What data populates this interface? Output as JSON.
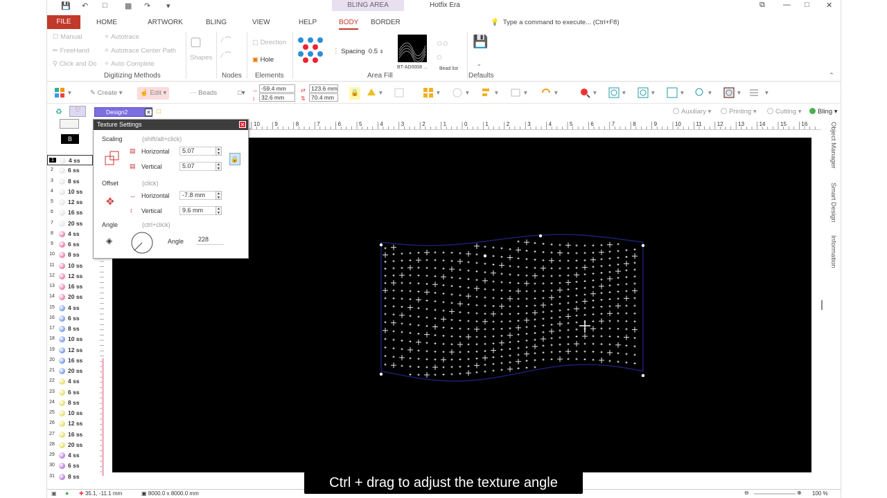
{
  "titlebar": {
    "context_tab": "BLING AREA",
    "app_title": "Hotfix Era"
  },
  "ribbon_tabs": {
    "file": "FILE",
    "tabs": [
      "HOME",
      "ARTWORK",
      "BLING",
      "VIEW",
      "HELP",
      "BODY",
      "BORDER"
    ],
    "active": "BODY",
    "tell_me": "Type a command to execute... (Ctrl+F8)"
  },
  "ribbon": {
    "digitizing": {
      "manual": "Manual",
      "freehand": "FreeHand",
      "click_and_do": "Click and Do",
      "autotrace": "Autotrace",
      "autotrace_center": "Autotrace Center Path",
      "auto_complete": "Auto Complete",
      "label": "Digitizing Methods"
    },
    "shapes_label": "Shapes",
    "nodes_label": "Nodes",
    "elements": {
      "direction": "Direction",
      "hole": "Hole",
      "label": "Elements"
    },
    "area_fill": {
      "spacing_label": "Spacing",
      "spacing_value": "0.5",
      "texture_name": "BT-AD0008 ...",
      "bead_list": "Bead list",
      "label": "Area Fill"
    },
    "defaults_label": "Defaults"
  },
  "toolbar": {
    "create": "Create",
    "edit": "Edit",
    "beads": "Beads",
    "x": "-59.4 mm",
    "y": "32.6 mm",
    "w": "123.6 mm",
    "h": "70.4 mm"
  },
  "doc": {
    "tab": "Design2"
  },
  "view_modes": [
    "Auxiliary",
    "Printing",
    "Cutting",
    "Bling"
  ],
  "left_list": {
    "header_letter": "B",
    "items": [
      {
        "n": "1",
        "size": "4 ss",
        "color": "#d8d8d8"
      },
      {
        "n": "2",
        "size": "6 ss",
        "color": "#d8d8d8"
      },
      {
        "n": "3",
        "size": "8 ss",
        "color": "#d8d8d8"
      },
      {
        "n": "4",
        "size": "10 ss",
        "color": "#d8d8d8"
      },
      {
        "n": "5",
        "size": "12 ss",
        "color": "#d8d8d8"
      },
      {
        "n": "6",
        "size": "16 ss",
        "color": "#d8d8d8"
      },
      {
        "n": "7",
        "size": "20 ss",
        "color": "#d8d8d8"
      },
      {
        "n": "8",
        "size": "4 ss",
        "color": "#e0408a"
      },
      {
        "n": "9",
        "size": "6 ss",
        "color": "#e0408a"
      },
      {
        "n": "10",
        "size": "8 ss",
        "color": "#e0408a"
      },
      {
        "n": "11",
        "size": "10 ss",
        "color": "#e0408a"
      },
      {
        "n": "12",
        "size": "12 ss",
        "color": "#e0408a"
      },
      {
        "n": "13",
        "size": "16 ss",
        "color": "#e0408a"
      },
      {
        "n": "14",
        "size": "20 ss",
        "color": "#e0408a"
      },
      {
        "n": "15",
        "size": "4 ss",
        "color": "#3a6ee0"
      },
      {
        "n": "16",
        "size": "6 ss",
        "color": "#3a6ee0"
      },
      {
        "n": "17",
        "size": "8 ss",
        "color": "#3a6ee0"
      },
      {
        "n": "18",
        "size": "10 ss",
        "color": "#3a6ee0"
      },
      {
        "n": "19",
        "size": "12 ss",
        "color": "#3a6ee0"
      },
      {
        "n": "20",
        "size": "16 ss",
        "color": "#3a6ee0"
      },
      {
        "n": "21",
        "size": "20 ss",
        "color": "#3a6ee0"
      },
      {
        "n": "22",
        "size": "4 ss",
        "color": "#d8d020"
      },
      {
        "n": "23",
        "size": "6 ss",
        "color": "#d8d020"
      },
      {
        "n": "24",
        "size": "8 ss",
        "color": "#d8d020"
      },
      {
        "n": "25",
        "size": "10 ss",
        "color": "#d8d020"
      },
      {
        "n": "26",
        "size": "12 ss",
        "color": "#d8d020"
      },
      {
        "n": "27",
        "size": "16 ss",
        "color": "#d8d020"
      },
      {
        "n": "28",
        "size": "20 ss",
        "color": "#d8d020"
      },
      {
        "n": "29",
        "size": "4 ss",
        "color": "#9b3ad0"
      },
      {
        "n": "30",
        "size": "6 ss",
        "color": "#9b3ad0"
      },
      {
        "n": "31",
        "size": "8 ss",
        "color": "#9b3ad0"
      }
    ]
  },
  "ruler_labels": [
    "10",
    "9",
    "8",
    "7",
    "6",
    "5",
    "4",
    "3",
    "2",
    "1",
    "0",
    "1",
    "2",
    "3",
    "4",
    "5",
    "6",
    "7",
    "8",
    "9",
    "10",
    "11",
    "12",
    "13",
    "14",
    "15",
    "16"
  ],
  "side_panels": [
    "Object Manager",
    "Smart Design",
    "Information"
  ],
  "texture_dialog": {
    "title": "Texture Settings",
    "scaling": {
      "label": "Scaling",
      "hint": "(shift/alt+click)",
      "h_label": "Horizontal",
      "h_value": "5.07",
      "v_label": "Vertical",
      "v_value": "5.07"
    },
    "offset": {
      "label": "Offset",
      "hint": "(click)",
      "h_label": "Horizontal",
      "h_value": "-7.8 mm",
      "v_label": "Vertical",
      "v_value": "9.6 mm"
    },
    "angle": {
      "label": "Angle",
      "hint": "(ctrl+click)",
      "field_label": "Angle",
      "value": "228"
    }
  },
  "status": {
    "coords": "35.1, -11.1 mm",
    "size": "8000.0 x 8000.0 mm",
    "zoom": "100 %"
  },
  "caption": "Ctrl + drag to adjust the texture angle"
}
